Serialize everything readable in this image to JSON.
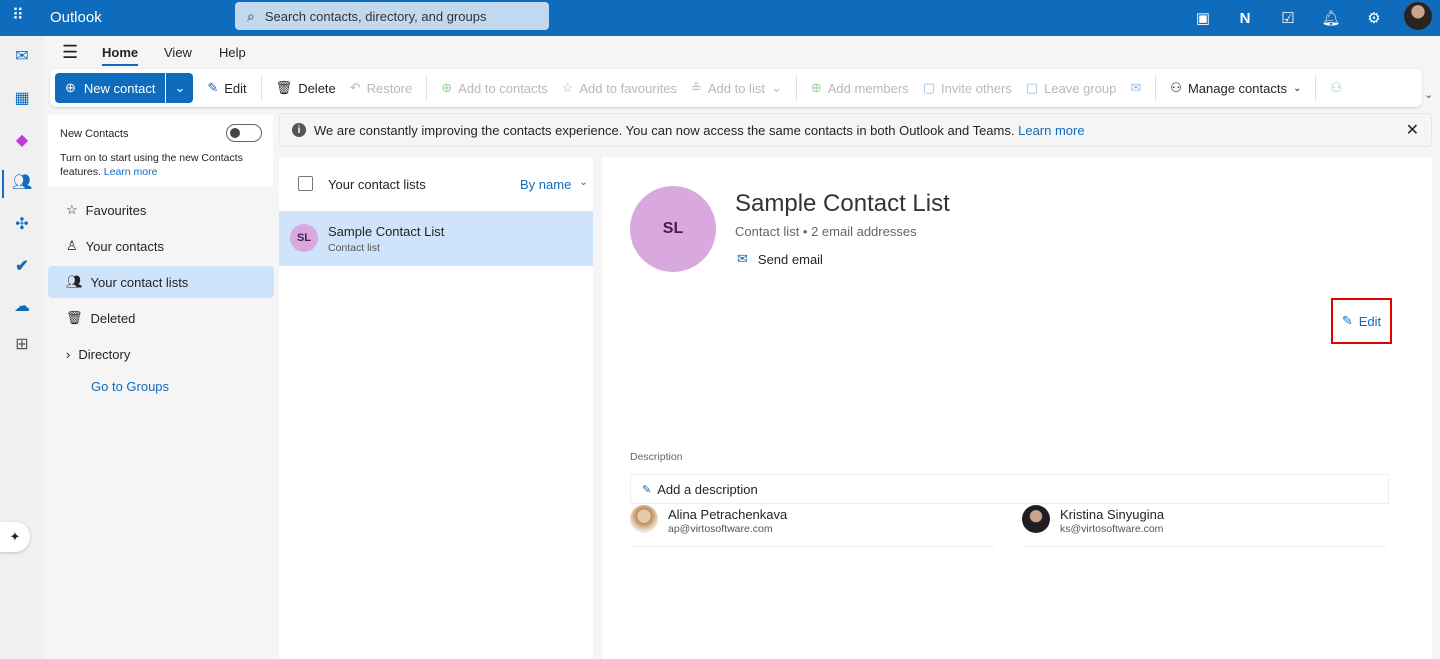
{
  "header": {
    "app_name": "Outlook",
    "search_placeholder": "Search contacts, directory, and groups",
    "icons": [
      "waffle-icon",
      "chat-icon",
      "onenote-icon",
      "todo-icon",
      "bell-icon",
      "gear-icon",
      "avatar"
    ]
  },
  "tabs": [
    {
      "label": "Home",
      "active": true
    },
    {
      "label": "View"
    },
    {
      "label": "Help"
    }
  ],
  "toolbar": {
    "new_contact": "New contact",
    "edit": "Edit",
    "delete": "Delete",
    "restore": "Restore",
    "add_to_contacts": "Add to contacts",
    "add_to_favourites": "Add to favourites",
    "add_to_list": "Add to list",
    "add_members": "Add members",
    "invite_others": "Invite others",
    "leave_group": "Leave group",
    "manage_contacts": "Manage contacts"
  },
  "sidebar": {
    "new_contacts_title": "New Contacts",
    "new_contacts_toggle": false,
    "new_contacts_desc": "Turn on to start using the new Contacts features.",
    "learn_more": "Learn more",
    "items": [
      {
        "label": "Favourites",
        "icon": "star-icon"
      },
      {
        "label": "Your contacts",
        "icon": "person-icon"
      },
      {
        "label": "Your contact lists",
        "icon": "people-list-icon",
        "selected": true
      },
      {
        "label": "Deleted",
        "icon": "trash-icon"
      },
      {
        "label": "Directory",
        "icon": "chevron-right-icon"
      }
    ],
    "go_to_groups": "Go to Groups"
  },
  "banner": {
    "text": "We are constantly improving the contacts experience. You can now access the same contacts in both Outlook and Teams.",
    "link": "Learn more"
  },
  "list": {
    "header": "Your contact lists",
    "sort": "By name",
    "items": [
      {
        "initials": "SL",
        "name": "Sample Contact List",
        "sub": "Contact list"
      }
    ]
  },
  "detail": {
    "initials": "SL",
    "title": "Sample Contact List",
    "subtitle": "Contact list • 2 email addresses",
    "send_email": "Send email",
    "edit": "Edit",
    "members": [
      {
        "name": "Alina Petrachenkava",
        "email": "ap@virtosoftware.com"
      },
      {
        "name": "Kristina Sinyugina",
        "email": "ks@virtosoftware.com"
      }
    ],
    "description_label": "Description",
    "description_placeholder": "Add a description"
  },
  "colors": {
    "brand": "#0f6cbd",
    "avatar_bg": "#d8a8de",
    "selected_bg": "#cfe4fa",
    "highlight_box": "#e00000"
  }
}
